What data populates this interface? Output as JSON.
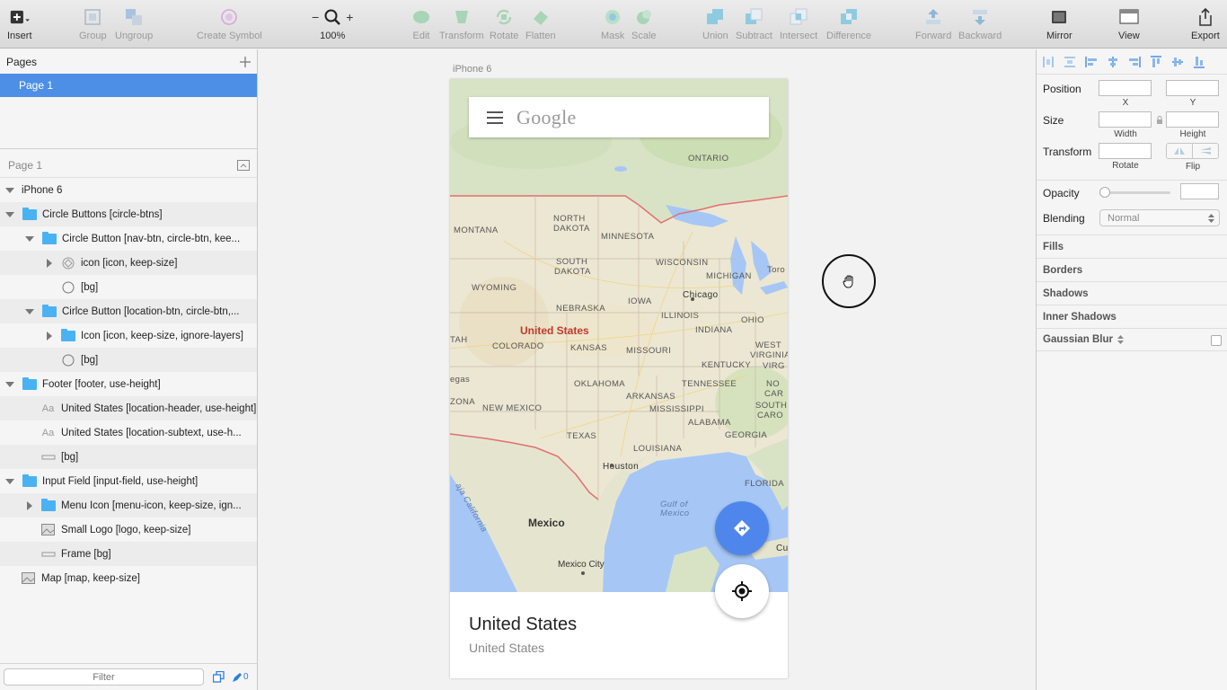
{
  "toolbar": {
    "insert": "Insert",
    "group": "Group",
    "ungroup": "Ungroup",
    "create_symbol": "Create Symbol",
    "zoom_level": "100%",
    "edit": "Edit",
    "transform": "Transform",
    "rotate": "Rotate",
    "flatten": "Flatten",
    "mask": "Mask",
    "scale": "Scale",
    "union": "Union",
    "subtract": "Subtract",
    "intersect": "Intersect",
    "difference": "Difference",
    "forward": "Forward",
    "backward": "Backward",
    "mirror": "Mirror",
    "view": "View",
    "export": "Export"
  },
  "pages": {
    "title": "Pages",
    "items": [
      "Page 1"
    ]
  },
  "layers": {
    "header": "Page 1",
    "items": [
      "iPhone 6",
      "Circle Buttons [circle-btns]",
      "Circle Button [nav-btn, circle-btn, kee...",
      "icon [icon, keep-size]",
      "[bg]",
      "Cirlce Button [location-btn, circle-btn,...",
      "Icon [icon, keep-size, ignore-layers]",
      "[bg]",
      "Footer [footer, use-height]",
      "United States [location-header, use-height]",
      "United States [location-subtext, use-h...",
      "[bg]",
      "Input Field [input-field, use-height]",
      "Menu Icon [menu-icon, keep-size, ign...",
      "Small Logo [logo, keep-size]",
      "Frame [bg]",
      "Map [map, keep-size]"
    ],
    "filter_placeholder": "Filter",
    "edit_count": "0"
  },
  "canvas": {
    "artboard_label": "iPhone 6",
    "logo": "Google",
    "map_labels": {
      "ontario": "ONTARIO",
      "montana": "MONTANA",
      "north_dakota_1": "NORTH",
      "north_dakota_2": "DAKOTA",
      "minnesota": "MINNESOTA",
      "south_dakota_1": "SOUTH",
      "south_dakota_2": "DAKOTA",
      "wisconsin": "WISCONSIN",
      "michigan": "MICHIGAN",
      "toronto": "Toro",
      "wyoming": "WYOMING",
      "nebraska": "NEBRASKA",
      "iowa": "IOWA",
      "chicago": "Chicago",
      "illinois": "ILLINOIS",
      "ohio": "OHIO",
      "united_states": "United States",
      "utah": "TAH",
      "colorado": "COLORADO",
      "kansas": "KANSAS",
      "missouri": "MISSOURI",
      "indiana": "INDIANA",
      "west_virginia_1": "WEST",
      "west_virginia_2": "VIRGINIA",
      "kentucky": "KENTUCKY",
      "virginia": "VIRG",
      "vegas": "egas",
      "arizona": "ZONA",
      "oklahoma": "OKLAHOMA",
      "tennessee": "TENNESSEE",
      "north_carolina": "NO",
      "north_carolina_2": "CAR",
      "arkansas": "ARKANSAS",
      "new_mexico": "NEW MEXICO",
      "mississippi": "MISSISSIPPI",
      "south_carolina_1": "SOUTH",
      "south_carolina_2": "CARO",
      "alabama": "ALABAMA",
      "georgia": "GEORGIA",
      "texas": "TEXAS",
      "louisiana": "LOUISIANA",
      "houston": "Houston",
      "florida": "FLORIDA",
      "gulf_1": "Gulf of",
      "gulf_2": "Mexico",
      "baja": "aja California",
      "mexico": "Mexico",
      "mexico_city": "Mexico City",
      "cuba": "Cu"
    },
    "location_header": "United States",
    "location_subtext": "United States"
  },
  "inspector": {
    "position": "Position",
    "x": "X",
    "y": "Y",
    "size": "Size",
    "width": "Width",
    "height": "Height",
    "transform": "Transform",
    "rotate": "Rotate",
    "flip": "Flip",
    "opacity": "Opacity",
    "blending": "Blending",
    "blending_value": "Normal",
    "fills": "Fills",
    "borders": "Borders",
    "shadows": "Shadows",
    "inner_shadows": "Inner Shadows",
    "gaussian_blur": "Gaussian Blur"
  },
  "colors": {
    "selection": "#4d8fe6",
    "folder": "#4ab2f3",
    "nav_button": "#4e86ec",
    "state_border": "#e07070"
  }
}
